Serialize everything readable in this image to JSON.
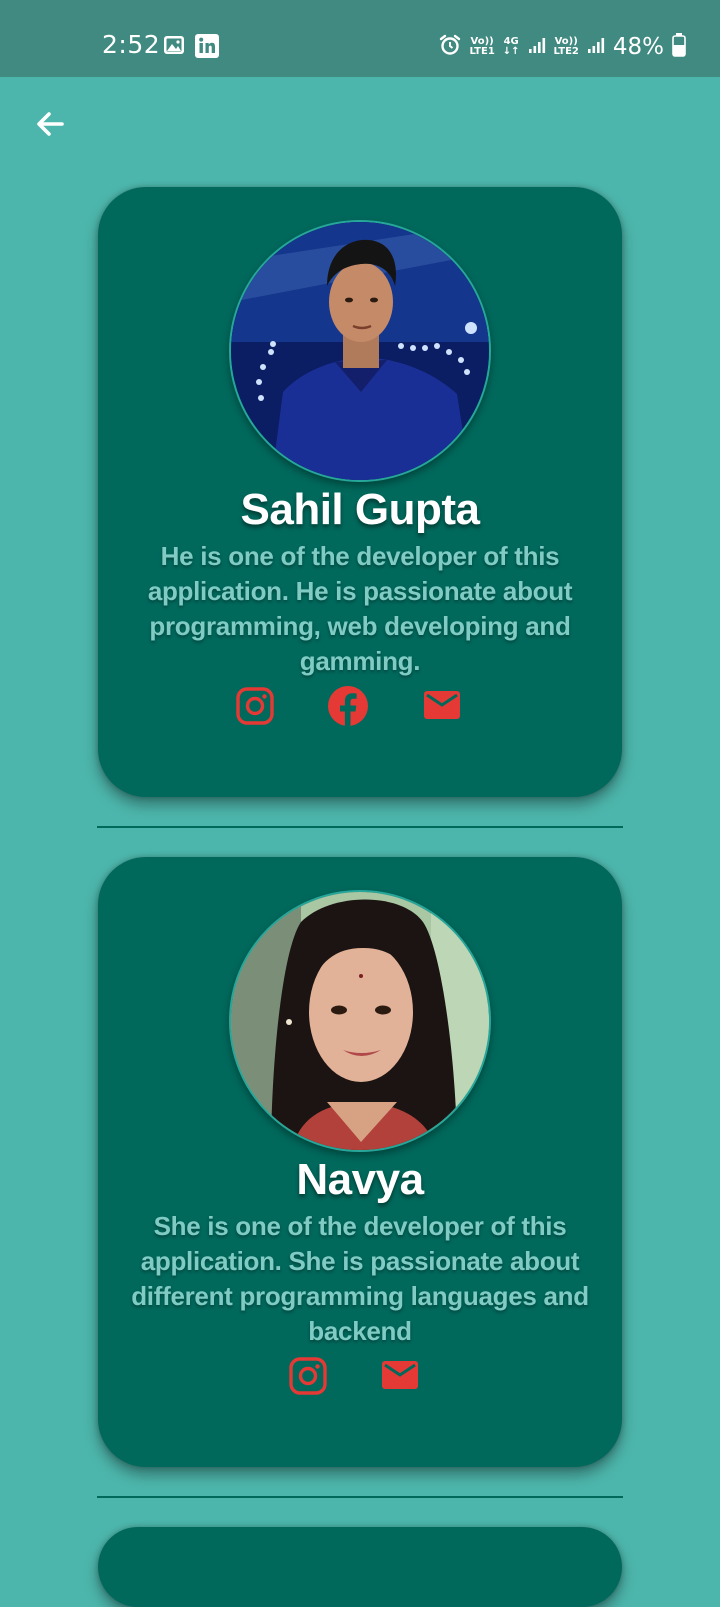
{
  "status_bar": {
    "time": "2:52",
    "sim1_label_top": "Vo))",
    "sim1_label_bottom": "LTE1",
    "network_type": "4G",
    "sim2_label_top": "Vo))",
    "sim2_label_bottom": "LTE2",
    "battery_percent": "48%",
    "icons": [
      "gallery-icon",
      "linkedin-icon",
      "alarm-icon",
      "signal-icon",
      "battery-icon"
    ]
  },
  "toolbar": {
    "back_icon": "arrow-left-icon"
  },
  "developers": [
    {
      "name": "Sahil Gupta",
      "bio": "He is one of the developer of this application. He is passionate about programming, web developing and gamming.",
      "socials": [
        "instagram",
        "facebook",
        "email"
      ]
    },
    {
      "name": "Navya",
      "bio": "She is one of the developer of this application. She is passionate about different programming languages and backend",
      "socials": [
        "instagram",
        "email"
      ]
    }
  ],
  "colors": {
    "background": "#4db6ac",
    "status_bar": "#408a81",
    "card": "#00695c",
    "name_text": "#ffffff",
    "bio_text": "#80cbc4",
    "social_icon": "#e53935"
  }
}
